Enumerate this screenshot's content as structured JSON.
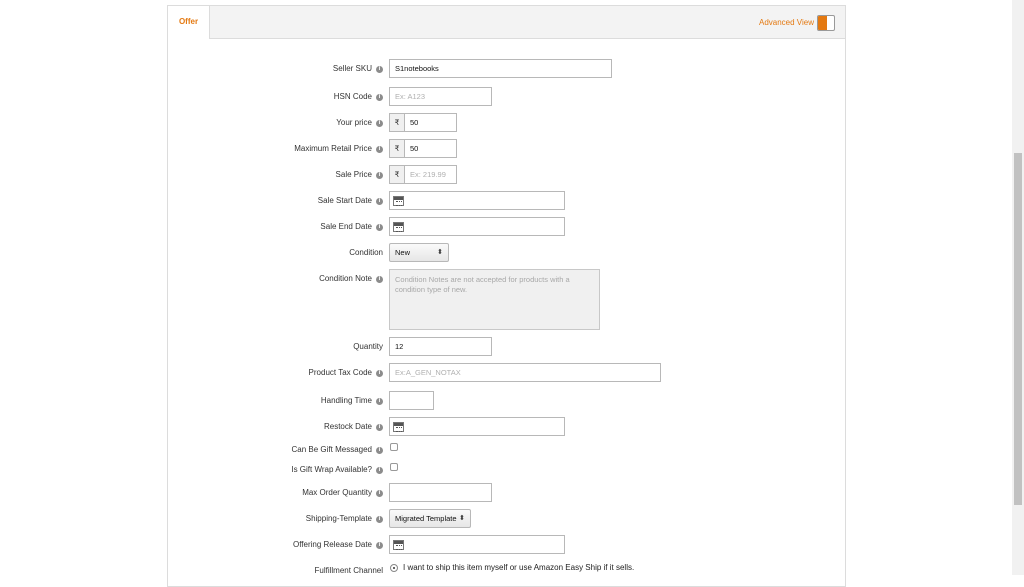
{
  "tabs": {
    "offer": "Offer"
  },
  "advanced_view": {
    "label": "Advanced View",
    "accent": "#e47911"
  },
  "currency_symbol": "₹",
  "info_icon": "i",
  "fields": {
    "seller_sku": {
      "label": "Seller SKU",
      "value": "S1notebooks"
    },
    "hsn_code": {
      "label": "HSN Code",
      "placeholder": "Ex: A123"
    },
    "your_price": {
      "label": "Your price",
      "value": "50"
    },
    "mrp": {
      "label": "Maximum Retail Price",
      "value": "50"
    },
    "sale_price": {
      "label": "Sale Price",
      "placeholder": "Ex: 219.99"
    },
    "sale_start_date": {
      "label": "Sale Start Date"
    },
    "sale_end_date": {
      "label": "Sale End Date"
    },
    "condition": {
      "label": "Condition",
      "value": "New"
    },
    "condition_note": {
      "label": "Condition Note",
      "placeholder": "Condition Notes are not accepted for products with a condition type of new."
    },
    "quantity": {
      "label": "Quantity",
      "value": "12"
    },
    "product_tax_code": {
      "label": "Product Tax Code",
      "placeholder": "Ex:A_GEN_NOTAX"
    },
    "handling_time": {
      "label": "Handling Time"
    },
    "restock_date": {
      "label": "Restock Date"
    },
    "gift_message": {
      "label": "Can Be Gift Messaged"
    },
    "gift_wrap": {
      "label": "Is Gift Wrap Available?"
    },
    "max_order_qty": {
      "label": "Max Order Quantity"
    },
    "shipping_template": {
      "label": "Shipping-Template",
      "value": "Migrated Template"
    },
    "offering_release_date": {
      "label": "Offering Release Date"
    },
    "fulfillment_channel": {
      "label": "Fulfillment Channel",
      "option_1": "I want to ship this item myself or use Amazon Easy Ship if it sells."
    }
  },
  "icons": {
    "info": "info-icon",
    "calendar": "calendar-icon",
    "toggle": "toggle-icon",
    "select_arrow": "updown-arrow-icon"
  },
  "arrow_glyph": "⬍"
}
